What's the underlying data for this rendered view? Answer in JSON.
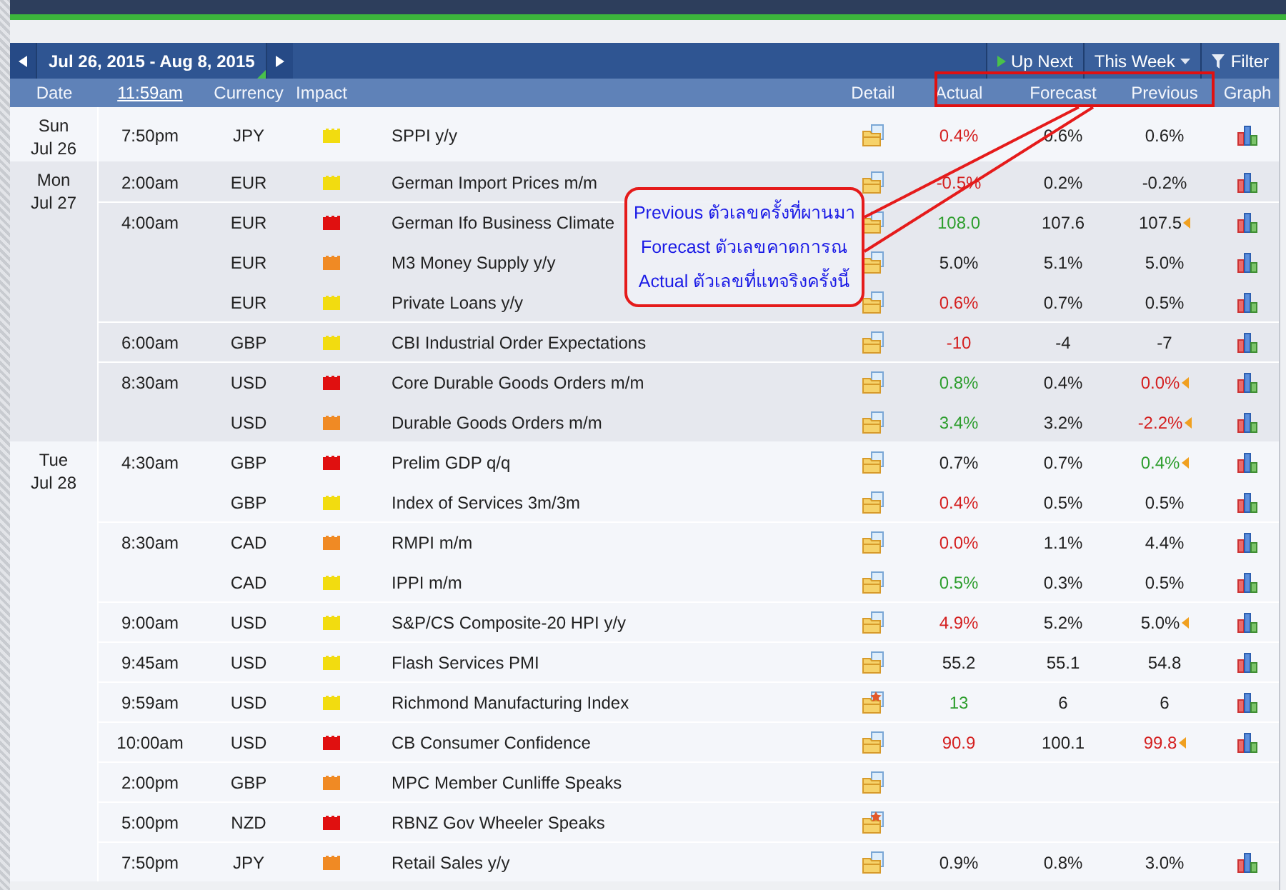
{
  "toolbar": {
    "range": "Jul 26, 2015 - Aug 8, 2015",
    "up_next": "Up Next",
    "period": "This Week",
    "filter": "Filter"
  },
  "columns": {
    "date": "Date",
    "time": "11:59am",
    "currency": "Currency",
    "impact": "Impact",
    "detail": "Detail",
    "actual": "Actual",
    "forecast": "Forecast",
    "previous": "Previous",
    "graph": "Graph"
  },
  "days": [
    {
      "day": "Sun",
      "date": "Jul 26",
      "rows": [
        {
          "time": "7:50pm",
          "currency": "JPY",
          "impact": {
            "color": "#f2dc10"
          },
          "event": "SPPI y/y",
          "starred": false,
          "actual": {
            "text": "0.4%",
            "color": "#d42020"
          },
          "forecast": "0.6%",
          "previous": {
            "text": "0.6%",
            "color": "#222222",
            "revised": false
          },
          "graph": true
        }
      ]
    },
    {
      "day": "Mon",
      "date": "Jul 27",
      "rows": [
        {
          "time": "2:00am",
          "currency": "EUR",
          "impact": {
            "color": "#f2dc10"
          },
          "event": "German Import Prices m/m",
          "starred": false,
          "actual": {
            "text": "-0.5%",
            "color": "#d42020"
          },
          "forecast": "0.2%",
          "previous": {
            "text": "-0.2%",
            "color": "#222222",
            "revised": false
          },
          "graph": true
        },
        {
          "time": "4:00am",
          "currency": "EUR",
          "impact": {
            "color": "#e01010"
          },
          "event": "German Ifo Business Climate",
          "starred": false,
          "actual": {
            "text": "108.0",
            "color": "#2e9e2e"
          },
          "forecast": "107.6",
          "previous": {
            "text": "107.5",
            "color": "#222222",
            "revised": true
          },
          "graph": true
        },
        {
          "currency": "EUR",
          "impact": {
            "color": "#f08a24"
          },
          "event": "M3 Money Supply y/y",
          "starred": false,
          "actual": {
            "text": "5.0%",
            "color": "#222222"
          },
          "forecast": "5.1%",
          "previous": {
            "text": "5.0%",
            "color": "#222222",
            "revised": false
          },
          "graph": true
        },
        {
          "currency": "EUR",
          "impact": {
            "color": "#f2dc10"
          },
          "event": "Private Loans y/y",
          "starred": false,
          "actual": {
            "text": "0.6%",
            "color": "#d42020"
          },
          "forecast": "0.7%",
          "previous": {
            "text": "0.5%",
            "color": "#222222",
            "revised": false
          },
          "graph": true
        },
        {
          "time": "6:00am",
          "currency": "GBP",
          "impact": {
            "color": "#f2dc10"
          },
          "event": "CBI Industrial Order Expectations",
          "starred": false,
          "actual": {
            "text": "-10",
            "color": "#d42020"
          },
          "forecast": "-4",
          "previous": {
            "text": "-7",
            "color": "#222222",
            "revised": false
          },
          "graph": true
        },
        {
          "time": "8:30am",
          "currency": "USD",
          "impact": {
            "color": "#e01010"
          },
          "event": "Core Durable Goods Orders m/m",
          "starred": false,
          "actual": {
            "text": "0.8%",
            "color": "#2e9e2e"
          },
          "forecast": "0.4%",
          "previous": {
            "text": "0.0%",
            "color": "#d42020",
            "revised": true
          },
          "graph": true
        },
        {
          "currency": "USD",
          "impact": {
            "color": "#f08a24"
          },
          "event": "Durable Goods Orders m/m",
          "starred": false,
          "actual": {
            "text": "3.4%",
            "color": "#2e9e2e"
          },
          "forecast": "3.2%",
          "previous": {
            "text": "-2.2%",
            "color": "#d42020",
            "revised": true
          },
          "graph": true
        }
      ]
    },
    {
      "day": "Tue",
      "date": "Jul 28",
      "rows": [
        {
          "time": "4:30am",
          "currency": "GBP",
          "impact": {
            "color": "#e01010"
          },
          "event": "Prelim GDP q/q",
          "starred": false,
          "actual": {
            "text": "0.7%",
            "color": "#222222"
          },
          "forecast": "0.7%",
          "previous": {
            "text": "0.4%",
            "color": "#2e9e2e",
            "revised": true
          },
          "graph": true
        },
        {
          "currency": "GBP",
          "impact": {
            "color": "#f2dc10"
          },
          "event": "Index of Services 3m/3m",
          "starred": false,
          "actual": {
            "text": "0.4%",
            "color": "#d42020"
          },
          "forecast": "0.5%",
          "previous": {
            "text": "0.5%",
            "color": "#222222",
            "revised": false
          },
          "graph": true
        },
        {
          "time": "8:30am",
          "currency": "CAD",
          "impact": {
            "color": "#f08a24"
          },
          "event": "RMPI m/m",
          "starred": false,
          "actual": {
            "text": "0.0%",
            "color": "#d42020"
          },
          "forecast": "1.1%",
          "previous": {
            "text": "4.4%",
            "color": "#222222",
            "revised": false
          },
          "graph": true
        },
        {
          "currency": "CAD",
          "impact": {
            "color": "#f2dc10"
          },
          "event": "IPPI m/m",
          "starred": false,
          "actual": {
            "text": "0.5%",
            "color": "#2e9e2e"
          },
          "forecast": "0.3%",
          "previous": {
            "text": "0.5%",
            "color": "#222222",
            "revised": false
          },
          "graph": true
        },
        {
          "time": "9:00am",
          "currency": "USD",
          "impact": {
            "color": "#f2dc10"
          },
          "event": "S&P/CS Composite-20 HPI y/y",
          "starred": false,
          "actual": {
            "text": "4.9%",
            "color": "#d42020"
          },
          "forecast": "5.2%",
          "previous": {
            "text": "5.0%",
            "color": "#222222",
            "revised": true
          },
          "graph": true
        },
        {
          "time": "9:45am",
          "currency": "USD",
          "impact": {
            "color": "#f2dc10"
          },
          "event": "Flash Services PMI",
          "starred": false,
          "actual": {
            "text": "55.2",
            "color": "#222222"
          },
          "forecast": "55.1",
          "previous": {
            "text": "54.8",
            "color": "#222222",
            "revised": false
          },
          "graph": true
        },
        {
          "time": "9:59am",
          "currency": "USD",
          "impact": {
            "color": "#f2dc10"
          },
          "event": "Richmond Manufacturing Index",
          "starred": true,
          "actual": {
            "text": "13",
            "color": "#2e9e2e"
          },
          "forecast": "6",
          "previous": {
            "text": "6",
            "color": "#222222",
            "revised": false
          },
          "graph": true
        },
        {
          "time": "10:00am",
          "currency": "USD",
          "impact": {
            "color": "#e01010"
          },
          "event": "CB Consumer Confidence",
          "starred": false,
          "actual": {
            "text": "90.9",
            "color": "#d42020"
          },
          "forecast": "100.1",
          "previous": {
            "text": "99.8",
            "color": "#d42020",
            "revised": true
          },
          "graph": true
        },
        {
          "time": "2:00pm",
          "currency": "GBP",
          "impact": {
            "color": "#f08a24"
          },
          "event": "MPC Member Cunliffe Speaks",
          "starred": false,
          "graph": false
        },
        {
          "time": "5:00pm",
          "currency": "NZD",
          "impact": {
            "color": "#e01010"
          },
          "event": "RBNZ Gov Wheeler Speaks",
          "starred": true,
          "graph": false
        },
        {
          "time": "7:50pm",
          "currency": "JPY",
          "impact": {
            "color": "#f08a24"
          },
          "event": "Retail Sales y/y",
          "starred": false,
          "actual": {
            "text": "0.9%",
            "color": "#222222"
          },
          "forecast": "0.8%",
          "previous": {
            "text": "3.0%",
            "color": "#222222",
            "revised": false
          },
          "graph": true
        }
      ]
    }
  ],
  "callout": {
    "lines": [
      "Previous ตัวเลขครั้งที่ผานมา",
      "Forecast ตัวเลขคาดการณ",
      "Actual ตัวเลขที่แทจริงครั้งนี้"
    ]
  }
}
